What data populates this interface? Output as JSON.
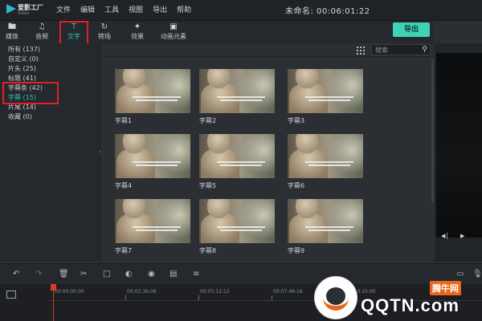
{
  "app": {
    "name": "爱影工厂",
    "name_sub": "Video"
  },
  "menu": [
    "文件",
    "编辑",
    "工具",
    "视图",
    "导出",
    "帮助"
  ],
  "project_title": "未命名: 00:06:01:22",
  "toolbar": [
    {
      "label": "媒体",
      "icon": "folder-icon"
    },
    {
      "label": "音频",
      "icon": "music-note-icon"
    },
    {
      "label": "文字",
      "icon": "text-icon",
      "active": true
    },
    {
      "label": "转场",
      "icon": "transition-icon"
    },
    {
      "label": "效果",
      "icon": "effects-icon"
    },
    {
      "label": "动画元素",
      "icon": "image-element-icon"
    }
  ],
  "export_label": "导出",
  "sidebar": [
    {
      "label": "所有 (137)"
    },
    {
      "label": "自定义 (0)"
    },
    {
      "label": "片头 (25)"
    },
    {
      "label": "标题 (41)"
    },
    {
      "label": "字幕条 (42)"
    },
    {
      "label": "字幕 (15)",
      "selected": true
    },
    {
      "label": "片尾 (14)"
    },
    {
      "label": "收藏 (0)"
    }
  ],
  "search": {
    "placeholder": "搜索"
  },
  "tiles": [
    "字幕1",
    "字幕2",
    "字幕3",
    "字幕4",
    "字幕5",
    "字幕6",
    "字幕7",
    "字幕8",
    "字幕9"
  ],
  "timeline": {
    "times": [
      "00:00:00:00",
      "00:02:36:06",
      "00:05:12:12",
      "00:07:48:18",
      "00:10:25:00"
    ]
  },
  "watermark": {
    "brand": "QQTN.com",
    "cn": "腾牛网"
  },
  "colors": {
    "accent": "#3fd2b7",
    "highlight": "#e0202a",
    "selected_text": "#2fc3b6"
  }
}
